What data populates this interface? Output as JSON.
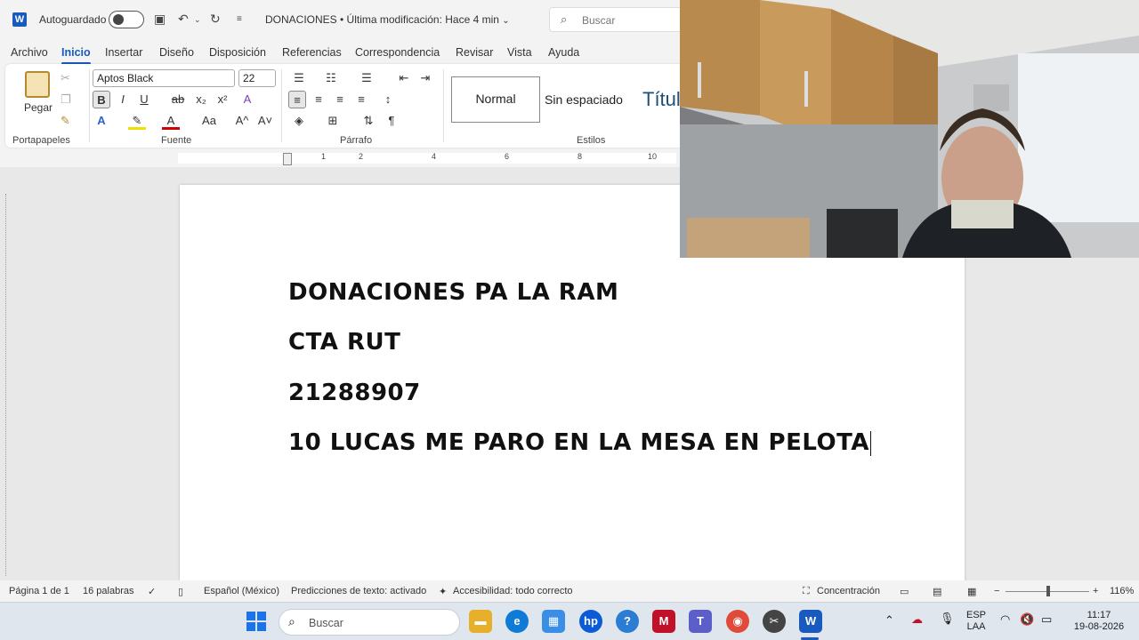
{
  "titlebar": {
    "autosave_label": "Autoguardado",
    "doc_title": "DONACIONES • Última modificación: Hace 4 min",
    "search_placeholder": "Buscar"
  },
  "menu_tabs": [
    {
      "label": "Archivo"
    },
    {
      "label": "Inicio",
      "active": true
    },
    {
      "label": "Insertar"
    },
    {
      "label": "Diseño"
    },
    {
      "label": "Disposición"
    },
    {
      "label": "Referencias"
    },
    {
      "label": "Correspondencia"
    },
    {
      "label": "Revisar"
    },
    {
      "label": "Vista"
    },
    {
      "label": "Ayuda"
    }
  ],
  "ribbon": {
    "paste_label": "Pegar",
    "font_name": "Aptos Black",
    "font_size": "22",
    "groups": {
      "clipboard": "Portapapeles",
      "font": "Fuente",
      "paragraph": "Párrafo",
      "styles": "Estilos"
    },
    "styles": {
      "normal": "Normal",
      "no_spacing": "Sin espaciado",
      "title": "Títul"
    },
    "buttons": {
      "bold": "B",
      "italic": "I",
      "underline": "U",
      "strike": "ab",
      "subscript": "x₂",
      "superscript": "x²",
      "grow": "A^",
      "shrink": "A˅",
      "case": "Aa",
      "pilcrow": "¶"
    }
  },
  "ruler_numbers": [
    "1",
    "2",
    "4",
    "6",
    "8",
    "10"
  ],
  "document": {
    "lines": [
      "DONACIONES PA LA RAM",
      "CTA RUT",
      "21288907",
      "10 LUCAS ME PARO EN LA MESA EN PELOTA"
    ]
  },
  "statusbar": {
    "page": "Página 1 de 1",
    "words": "16 palabras",
    "language": "Español (México)",
    "predictions": "Predicciones de texto: activado",
    "accessibility": "Accesibilidad: todo correcto",
    "focus": "Concentración",
    "zoom": "116%"
  },
  "taskbar": {
    "search_placeholder": "Buscar",
    "lang_top": "ESP",
    "lang_bottom": "LAA",
    "time": "11:17",
    "date": "19-08-2026"
  }
}
